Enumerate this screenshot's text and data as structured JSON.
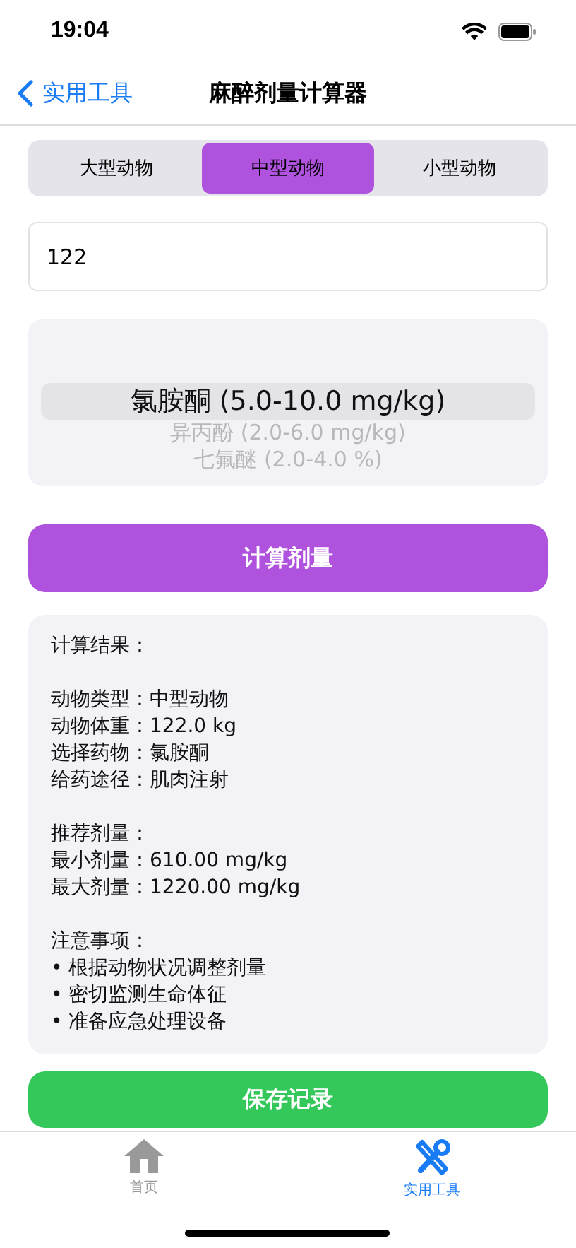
{
  "status_bar": {
    "time": "19:04"
  },
  "nav": {
    "back": "实用工具",
    "title": "麻醉剂量计算器"
  },
  "segments": [
    {
      "label": "大型动物",
      "selected": false
    },
    {
      "label": "中型动物",
      "selected": true
    },
    {
      "label": "小型动物",
      "selected": false
    }
  ],
  "weight_field": {
    "value": "122"
  },
  "picker": [
    {
      "label": "氯胺酮 (5.0-10.0 mg/kg)",
      "selected": true,
      "kind": "center"
    },
    {
      "label": "异丙酚 (2.0-6.0 mg/kg)",
      "selected": false,
      "kind": "after"
    },
    {
      "label": "七氟醚 (2.0-4.0 %)",
      "selected": false,
      "kind": "after"
    }
  ],
  "calculate_button": "计算剂量",
  "result": {
    "sections": [
      {
        "lines": [
          "计算结果："
        ]
      },
      {
        "lines": [
          "动物类型：中型动物",
          "动物体重：122.0 kg",
          "选择药物：氯胺酮",
          "给药途径：肌肉注射"
        ]
      },
      {
        "lines": [
          "推荐剂量：",
          "最小剂量：610.00 mg/kg",
          "最大剂量：1220.00 mg/kg"
        ]
      },
      {
        "lines": [
          "注意事项：",
          "• 根据动物状况调整剂量",
          "• 密切监测生命体征",
          "• 准备应急处理设备"
        ]
      }
    ]
  },
  "save_button": "保存记录",
  "tab_bar": [
    {
      "label": "首页",
      "selected": false,
      "kind": "home"
    },
    {
      "label": "实用工具",
      "selected": true,
      "kind": "tools"
    }
  ]
}
